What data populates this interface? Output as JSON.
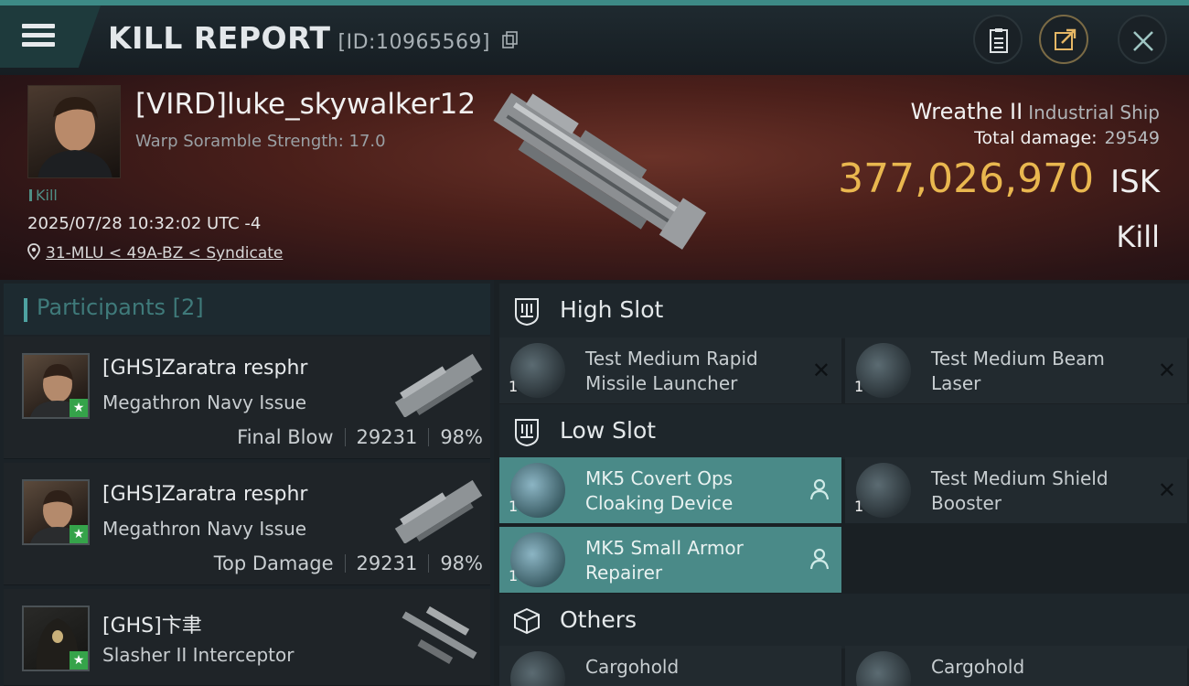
{
  "header": {
    "title": "KILL REPORT",
    "id_text": "[ID:10965569]"
  },
  "victim": {
    "name": "[VIRD]luke_skywalker12",
    "warp_scramble": "Warp Soramble Strength: 17.0",
    "tag": "Kill",
    "datetime": "2025/07/28 10:32:02 UTC -4",
    "location": "31-MLU < 49A-BZ < Syndicate",
    "ship_name": "Wreathe II",
    "ship_class": "Industrial Ship",
    "total_damage_label": "Total damage:",
    "total_damage_value": "29549",
    "isk_value": "377,026,970",
    "isk_unit": "ISK",
    "result": "Kill"
  },
  "participants": {
    "title": "Participants [2]",
    "rows": [
      {
        "name": "[GHS]Zaratra resphr",
        "ship": "Megathron Navy Issue",
        "role": "Final Blow",
        "damage": "29231",
        "pct": "98%"
      },
      {
        "name": "[GHS]Zaratra resphr",
        "ship": "Megathron Navy Issue",
        "role": "Top Damage",
        "damage": "29231",
        "pct": "98%"
      },
      {
        "name": "[GHS]卞聿",
        "ship": "Slasher II Interceptor",
        "role": "",
        "damage": "",
        "pct": ""
      }
    ]
  },
  "slots": {
    "high": {
      "label": "High Slot",
      "items": [
        {
          "qty": "1",
          "name": "Test Medium Rapid Missile Launcher"
        },
        {
          "qty": "1",
          "name": "Test Medium Beam Laser"
        }
      ]
    },
    "low": {
      "label": "Low Slot",
      "items": [
        {
          "qty": "1",
          "name": "MK5 Covert Ops Cloaking Device"
        },
        {
          "qty": "1",
          "name": "Test Medium Shield Booster"
        },
        {
          "qty": "1",
          "name": "MK5 Small Armor Repairer"
        }
      ]
    },
    "others": {
      "label": "Others",
      "items": [
        {
          "qty": "",
          "name": "Cargohold"
        },
        {
          "qty": "",
          "name": "Cargohold"
        }
      ]
    }
  },
  "icons": {
    "menu": "hamburger-icon",
    "copy": "copy-icon",
    "clipboard": "clipboard-icon",
    "share": "share-icon",
    "close": "close-icon"
  },
  "colors": {
    "accent": "#4a8a88",
    "isk": "#e9b74f",
    "star": "#35a34a"
  }
}
